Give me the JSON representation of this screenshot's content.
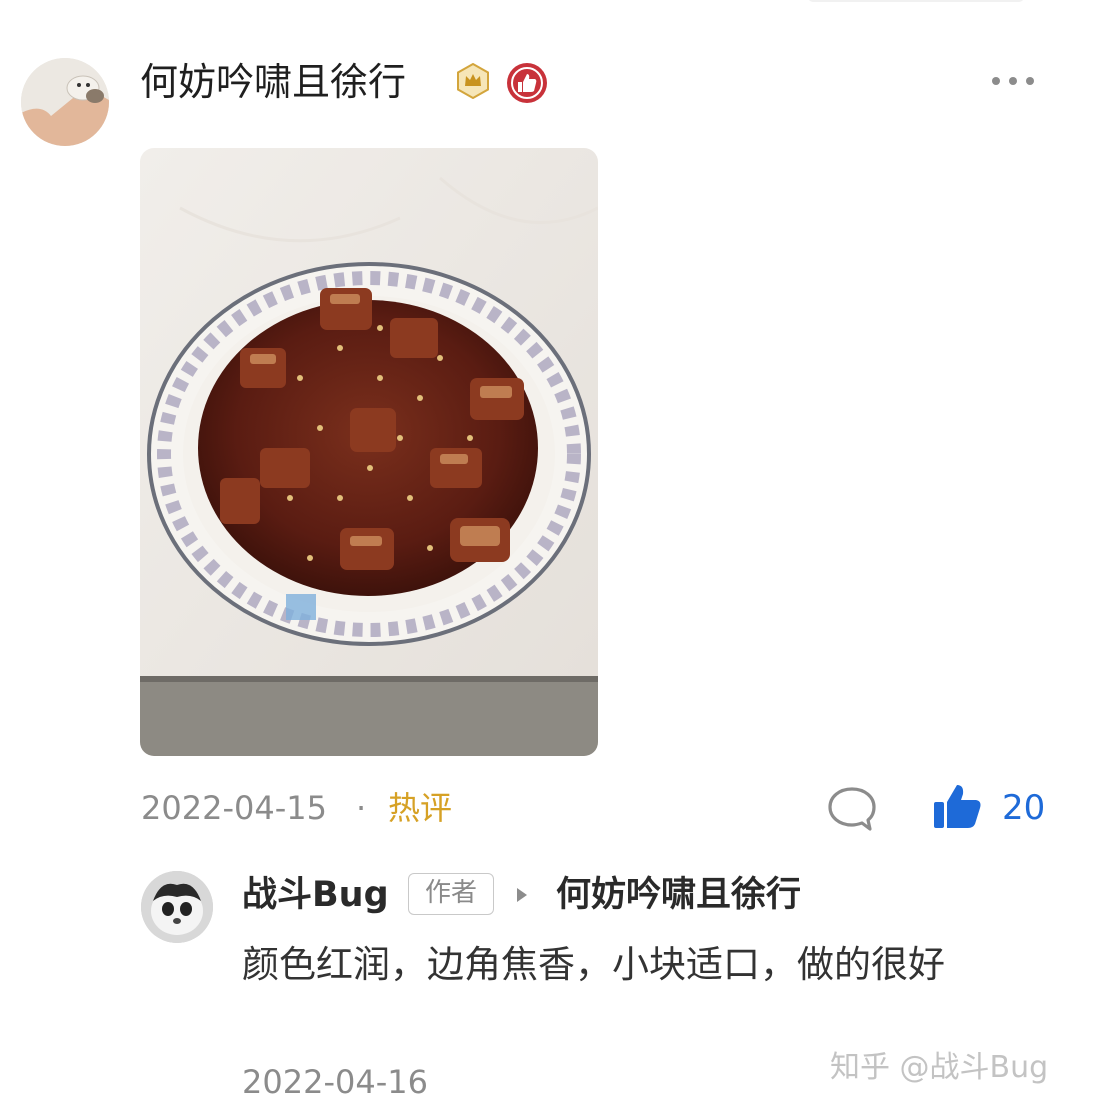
{
  "post": {
    "username": "何妨吟啸且徐行",
    "date": "2022-04-15",
    "separator": "·",
    "hot_label": "热评",
    "like_count": "20"
  },
  "reply": {
    "username": "战斗Bug",
    "author_tag": "作者",
    "reply_to": "何妨吟啸且徐行",
    "text": "颜色红润，边角焦香，小块适口，做的很好",
    "date": "2022-04-16"
  },
  "watermark": "知乎 @战斗Bug",
  "icons": {
    "more": "more-dots-icon",
    "comment": "comment-bubble-icon",
    "like": "thumbs-up-icon",
    "crown_badge": "crown-badge-icon",
    "like_badge": "like-badge-icon"
  },
  "colors": {
    "accent_blue": "#1e6ad8",
    "hot_gold": "#d6a125",
    "meta_gray": "#8b8b8b",
    "badge_red": "#c8323a"
  }
}
